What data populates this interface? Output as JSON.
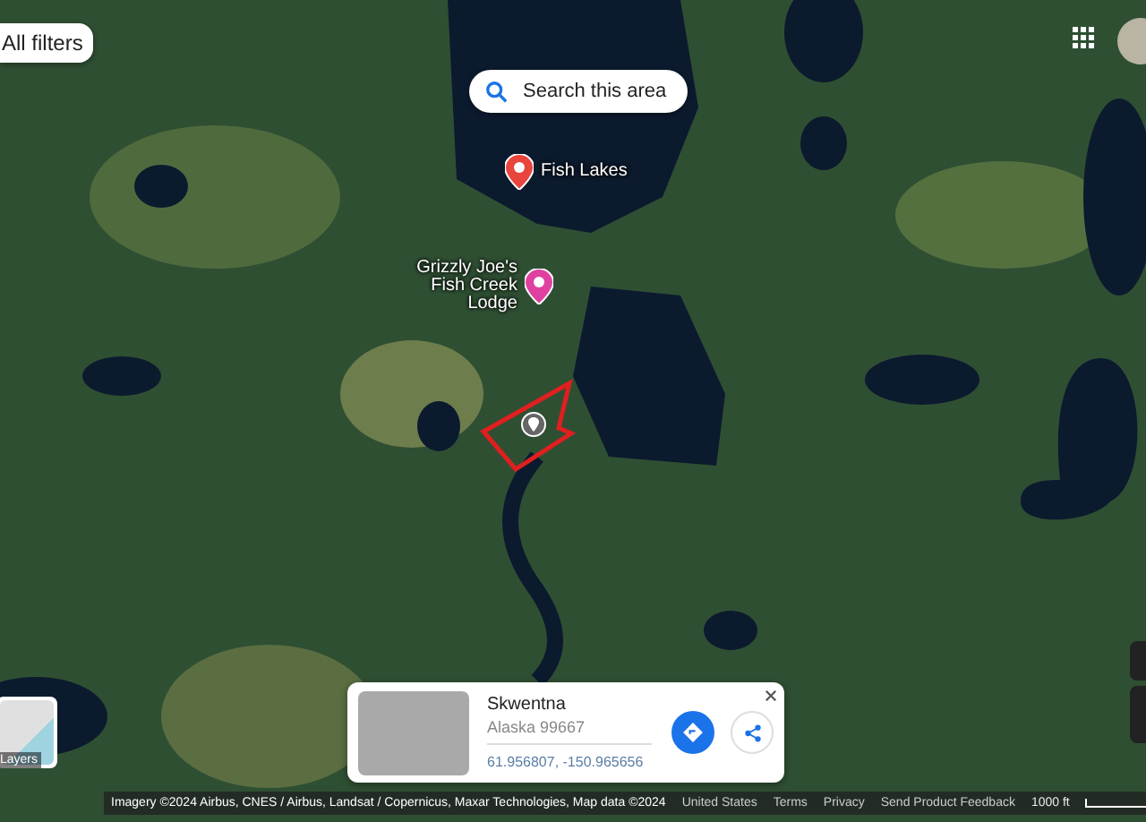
{
  "top_bar": {
    "filters_button": "All filters",
    "search_area_button": "Search this area"
  },
  "map_labels": [
    {
      "kind": "place",
      "text": "Fish Lakes"
    },
    {
      "kind": "lodging",
      "text": "Grizzly Joe's Fish Creek Lodge"
    }
  ],
  "layers_button": {
    "label": "Layers"
  },
  "place_card": {
    "title": "Skwentna",
    "subtitle": "Alaska 99667",
    "coordinates": "61.956807, -150.965656"
  },
  "footer": {
    "attribution": "Imagery ©2024 Airbus, CNES / Airbus, Landsat / Copernicus, Maxar Technologies, Map data ©2024",
    "links": [
      "United States",
      "Terms",
      "Privacy",
      "Send Product Feedback"
    ],
    "scale": "1000 ft"
  }
}
